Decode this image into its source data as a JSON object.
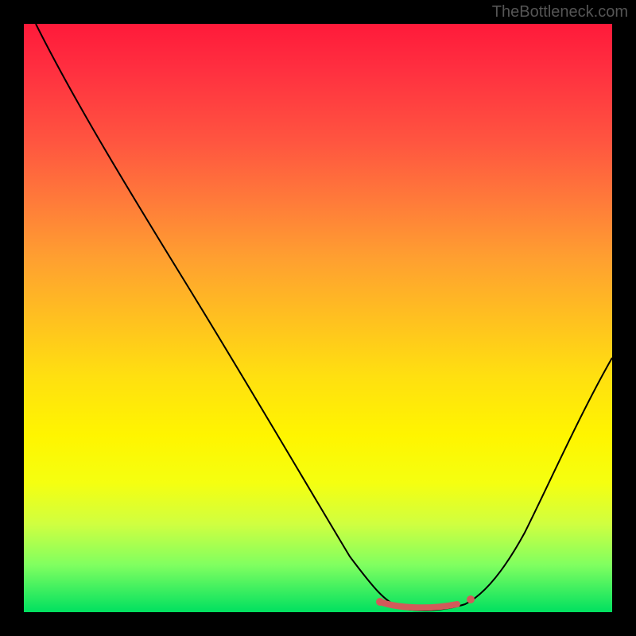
{
  "watermark": "TheBottleneck.com",
  "chart_data": {
    "type": "line",
    "title": "",
    "xlabel": "",
    "ylabel": "",
    "xlim": [
      0,
      100
    ],
    "ylim": [
      0,
      100
    ],
    "series": [
      {
        "name": "bottleneck-curve",
        "x": [
          2,
          10,
          20,
          30,
          40,
          50,
          55,
          60,
          63,
          66,
          70,
          75,
          80,
          85,
          90,
          95,
          100
        ],
        "y": [
          100,
          87,
          72,
          57,
          42,
          27,
          17,
          8,
          3,
          1,
          0.5,
          1,
          3,
          8,
          15,
          25,
          38
        ]
      }
    ],
    "highlight": {
      "name": "optimal-range",
      "x_start": 60,
      "x_end": 76,
      "y": 0.5
    },
    "background_gradient": {
      "top": "#ff1a3a",
      "bottom": "#00e060"
    }
  }
}
